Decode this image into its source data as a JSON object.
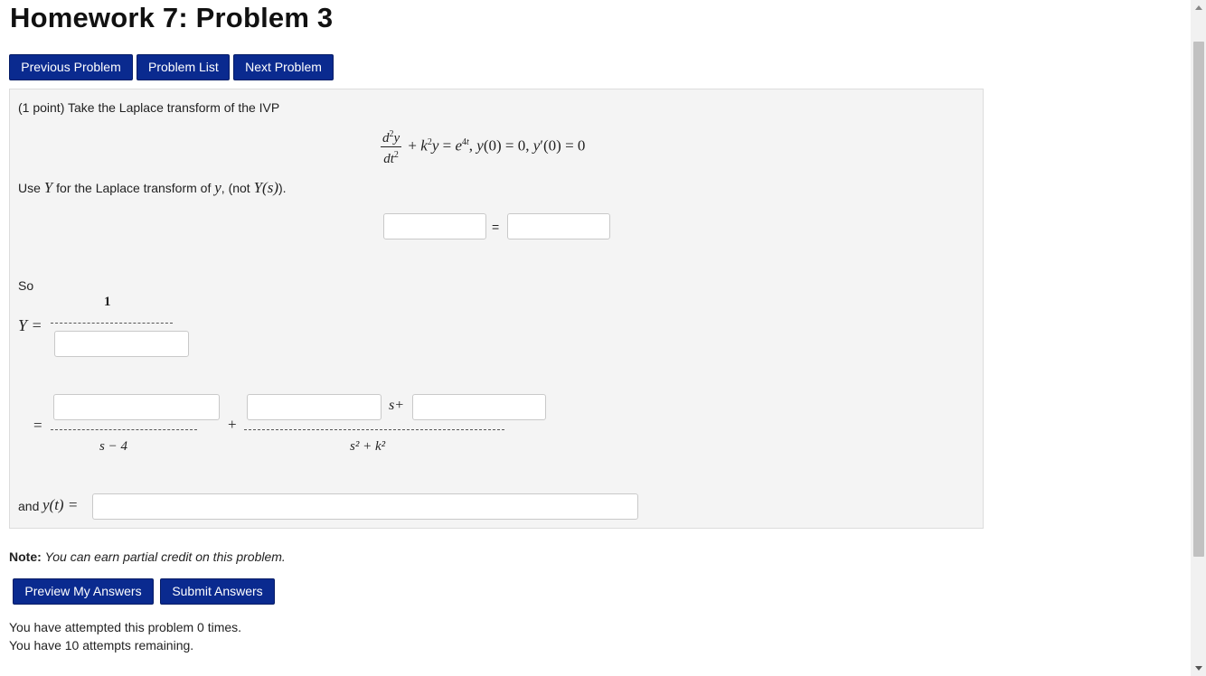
{
  "header": {
    "title": "Homework 7: Problem 3"
  },
  "nav": {
    "previous": "Previous Problem",
    "list": "Problem List",
    "next": "Next Problem"
  },
  "problem": {
    "intro": "(1 point) Take the Laplace transform of the IVP",
    "use_prefix": "Use",
    "use_middle": "for the Laplace transform of",
    "use_mid2": ", (not",
    "use_suffix": ").",
    "var_Y": "Y",
    "var_y": "y",
    "var_Ys": "Y(s)",
    "equals": "=",
    "so_label": "So",
    "Y_label": "Y =",
    "one": "1",
    "eq_sign": "=",
    "plus": "+",
    "s_plus": "s+",
    "den1": "s − 4",
    "den2": "s² + k²",
    "and_label": "and",
    "yt_label": "y(t) ="
  },
  "note": {
    "label": "Note:",
    "text": "You can earn partial credit on this problem."
  },
  "actions": {
    "preview": "Preview My Answers",
    "submit": "Submit Answers"
  },
  "status": {
    "attempted": "You have attempted this problem 0 times.",
    "remaining": "You have 10 attempts remaining."
  }
}
